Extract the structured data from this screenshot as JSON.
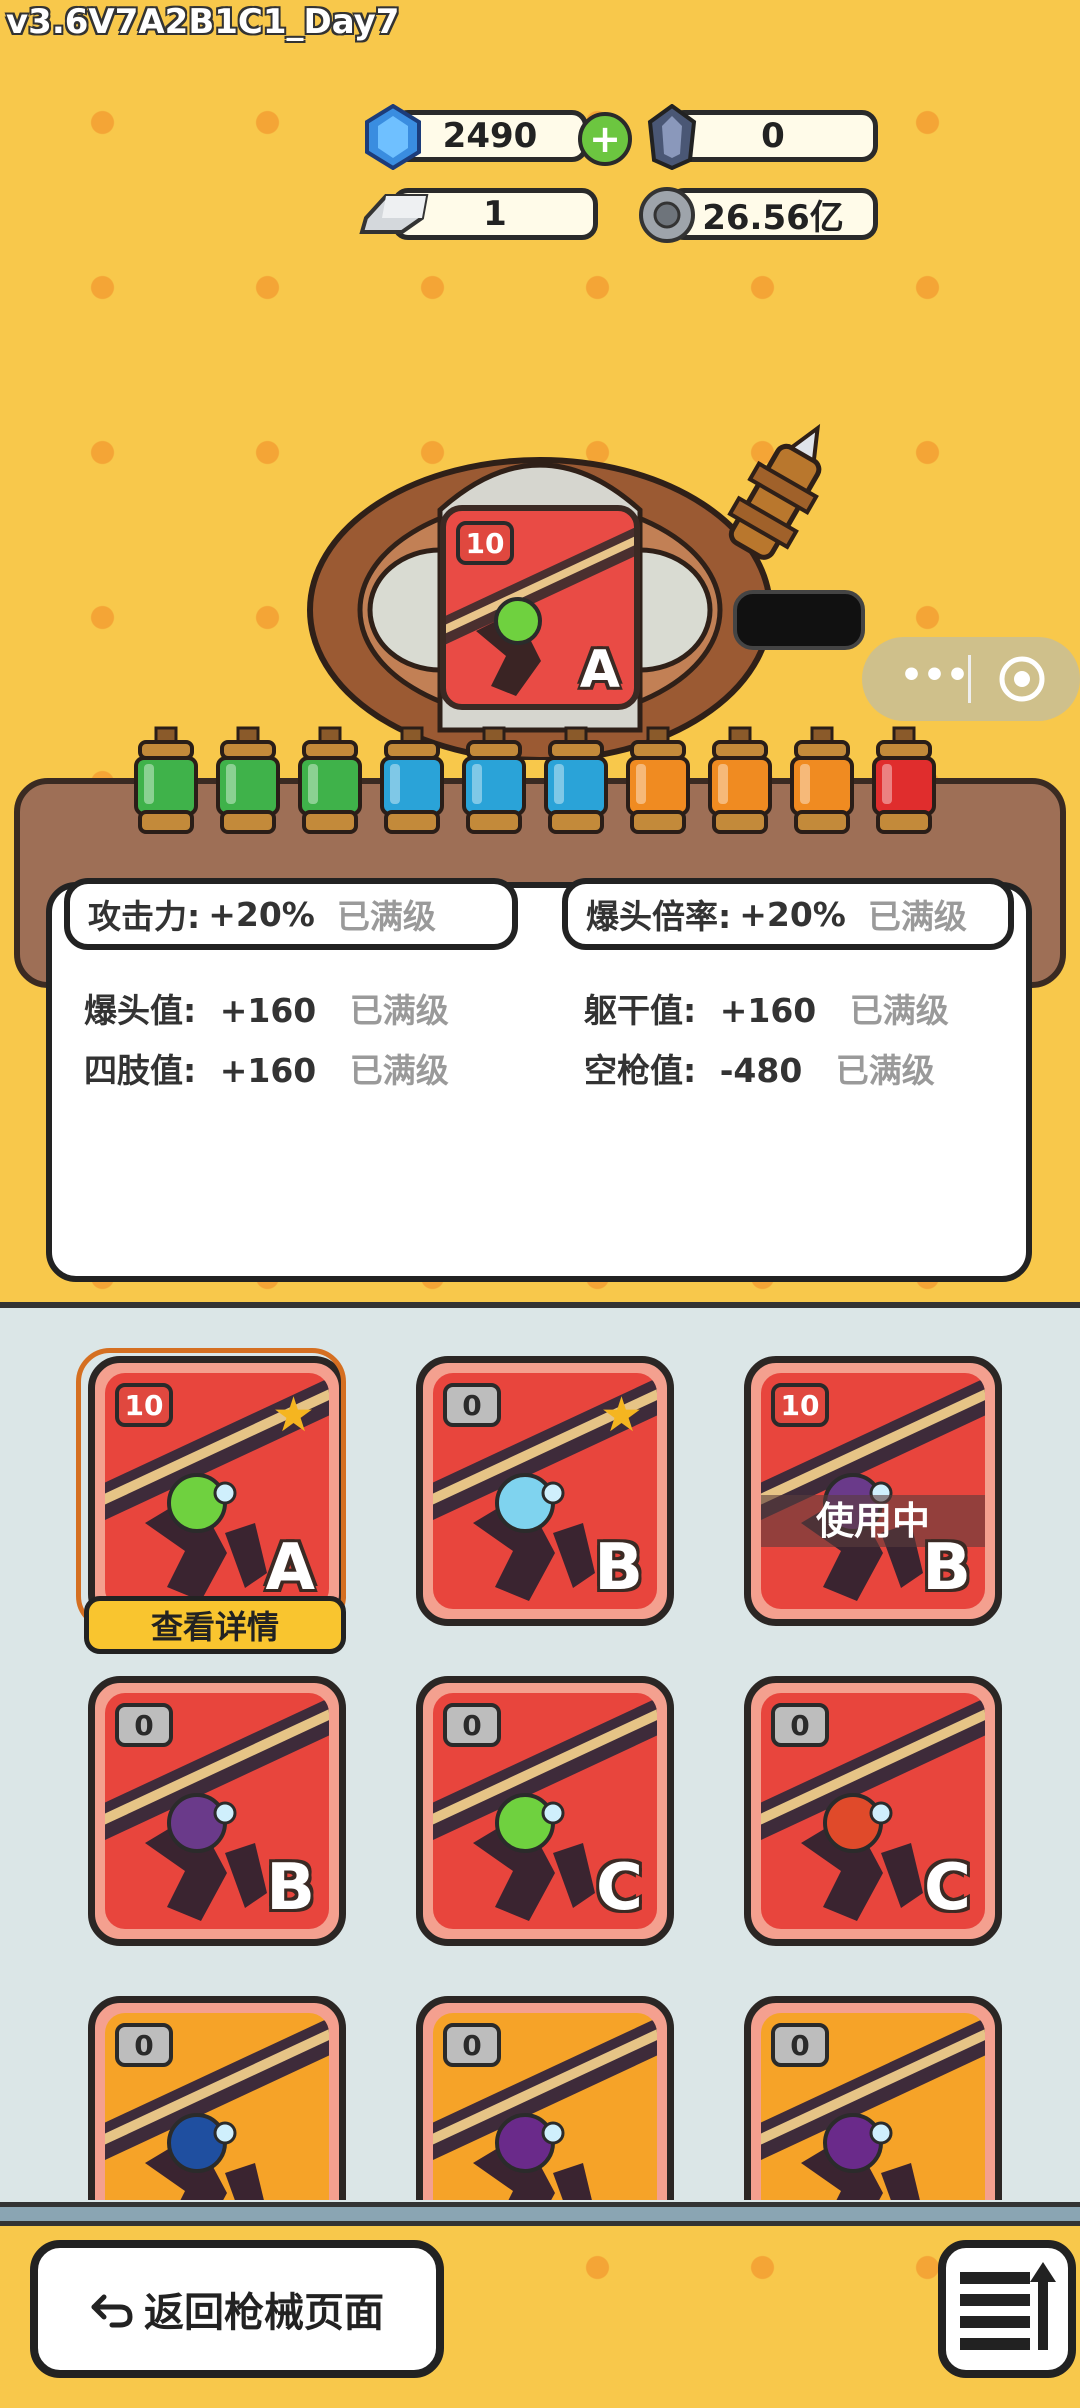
{
  "version_label": "v3.6V7A2B1C1_Day7",
  "currencies": {
    "gem": {
      "value": "2490",
      "icon": "blue-gem-icon"
    },
    "dark_gem": {
      "value": "0",
      "icon": "dark-crystal-icon"
    },
    "silver_bar": {
      "value": "1",
      "icon": "silver-bar-icon"
    },
    "coin": {
      "value": "26.56亿",
      "icon": "gear-coin-icon"
    }
  },
  "machine": {
    "current_gun": {
      "level": "10",
      "grade": "A"
    },
    "vials": [
      "#3fb24a",
      "#3fb24a",
      "#3fb24a",
      "#2aa3d8",
      "#2aa3d8",
      "#2aa3d8",
      "#f08b21",
      "#f08b21",
      "#f08b21",
      "#e02d2d"
    ]
  },
  "stats": {
    "head_left": {
      "label": "攻击力:",
      "value": "+20%",
      "status": "已满级"
    },
    "head_right": {
      "label": "爆头倍率:",
      "value": "+20%",
      "status": "已满级"
    },
    "lines": [
      {
        "label": "爆头值:",
        "value": "+160",
        "status": "已满级"
      },
      {
        "label": "躯干值:",
        "value": "+160",
        "status": "已满级"
      },
      {
        "label": "四肢值:",
        "value": "+160",
        "status": "已满级"
      },
      {
        "label": "空枪值:",
        "value": "-480",
        "status": "已满级"
      }
    ]
  },
  "guns": [
    {
      "level": "10",
      "grade": "A",
      "star": true,
      "bg": "red",
      "orb": "#6fd13f",
      "badge": "red"
    },
    {
      "level": "0",
      "grade": "B",
      "star": true,
      "bg": "red",
      "orb": "#7fd3ef",
      "badge": "gray"
    },
    {
      "level": "10",
      "grade": "B",
      "star": false,
      "bg": "red",
      "orb": "#6a3a8a",
      "badge": "red",
      "in_use": "使用中"
    },
    {
      "level": "0",
      "grade": "B",
      "star": false,
      "bg": "red",
      "orb": "#6a3a8a",
      "badge": "gray"
    },
    {
      "level": "0",
      "grade": "C",
      "star": false,
      "bg": "red",
      "orb": "#6fd13f",
      "badge": "gray"
    },
    {
      "level": "0",
      "grade": "C",
      "star": false,
      "bg": "red",
      "orb": "#e04a2a",
      "badge": "gray"
    },
    {
      "level": "0",
      "grade": "",
      "star": false,
      "bg": "orange",
      "orb": "#1f4fa0",
      "badge": "gray"
    },
    {
      "level": "0",
      "grade": "",
      "star": false,
      "bg": "orange",
      "orb": "#6a2a8a",
      "badge": "gray"
    },
    {
      "level": "0",
      "grade": "",
      "star": false,
      "bg": "orange",
      "orb": "#6a2a8a",
      "badge": "gray"
    }
  ],
  "detail_button": "查看详情",
  "back_button": "返回枪械页面",
  "icons": {
    "back": "back-arrow-icon",
    "menu": "list-sort-icon",
    "more": "more-dots-icon",
    "target": "target-icon"
  }
}
